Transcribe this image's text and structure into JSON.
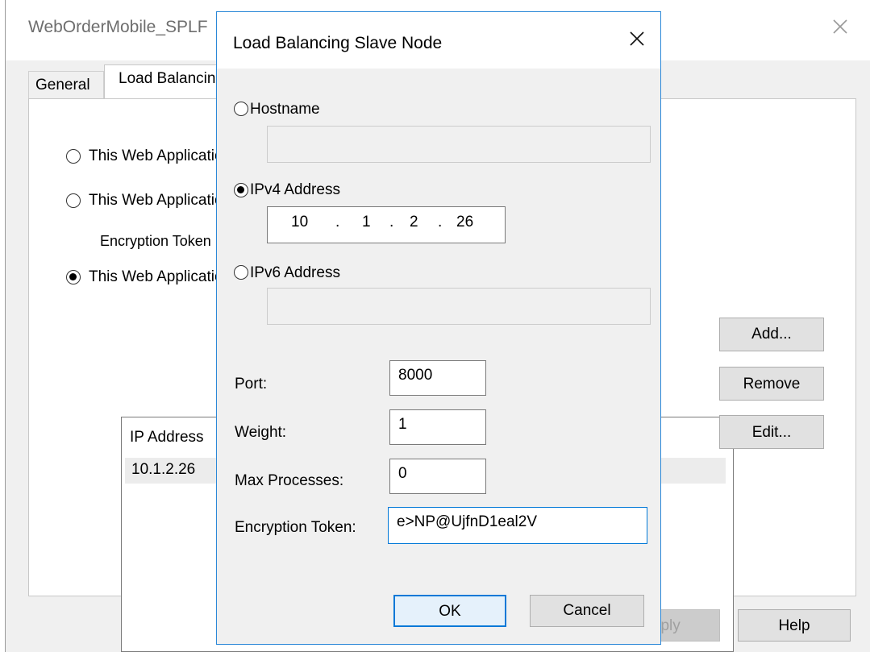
{
  "parent": {
    "title": "WebOrderMobile_SPLF",
    "tabs": [
      "General",
      "Load Balancing"
    ],
    "radios": [
      {
        "label": "This Web Application",
        "checked": false
      },
      {
        "label": "This Web Application",
        "checked": false
      },
      {
        "label": "This Web Application",
        "checked": true
      }
    ],
    "encryption_label": "Encryption Token",
    "list": {
      "header": "IP Address",
      "rows": [
        "10.1.2.26"
      ]
    },
    "buttons": {
      "add": "Add...",
      "remove": "Remove",
      "edit": "Edit...",
      "apply": "Apply",
      "help": "Help"
    }
  },
  "dialog": {
    "title": "Load Balancing Slave Node",
    "hostname": {
      "label": "Hostname",
      "checked": false,
      "value": ""
    },
    "ipv4": {
      "label": "IPv4 Address",
      "checked": true,
      "octets": [
        "10",
        "1",
        "2",
        "26"
      ],
      "separator": "."
    },
    "ipv6": {
      "label": "IPv6 Address",
      "checked": false,
      "value": ""
    },
    "port": {
      "label": "Port:",
      "value": "8000"
    },
    "weight": {
      "label": "Weight:",
      "value": "1"
    },
    "max_processes": {
      "label": "Max Processes:",
      "value": "0"
    },
    "encryption_token": {
      "label": "Encryption Token:",
      "value": "e>NP@UjfnD1eal2V"
    },
    "buttons": {
      "ok": "OK",
      "cancel": "Cancel"
    }
  },
  "colors": {
    "dialog_border": "#2b88d8",
    "window_bg": "#f0f0f0",
    "focus_border": "#0078d7"
  },
  "icons": {
    "close": "close-icon"
  }
}
